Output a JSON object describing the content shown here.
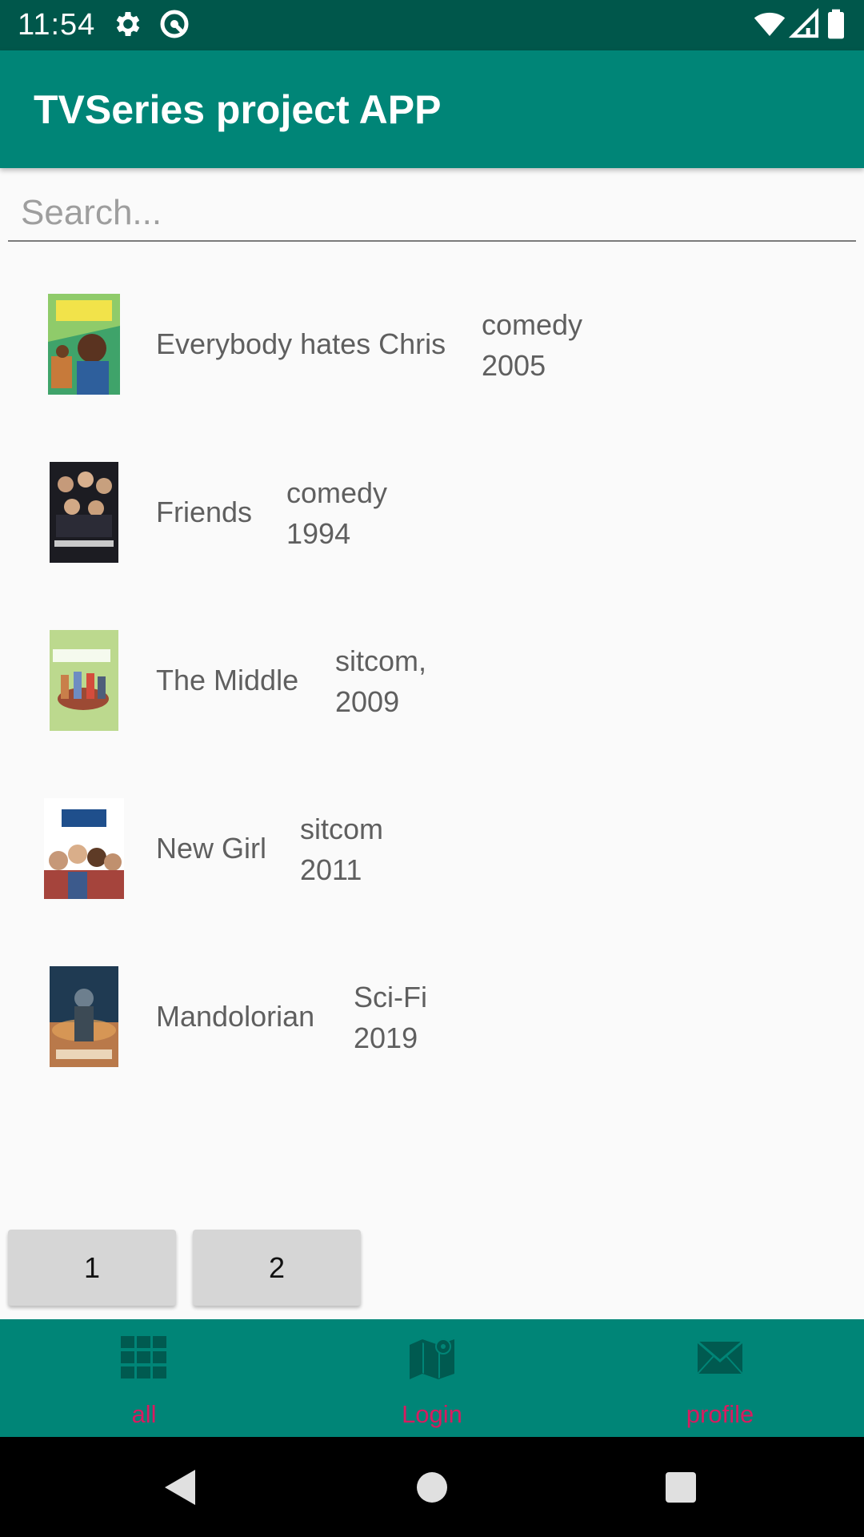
{
  "status_bar": {
    "time": "11:54",
    "icons": [
      "gear-icon",
      "no-sync-icon",
      "wifi-icon",
      "signal-icon",
      "battery-icon"
    ]
  },
  "app_bar": {
    "title": "TVSeries project APP",
    "color": "#008577"
  },
  "search": {
    "placeholder": "Search..."
  },
  "series": [
    {
      "name": "Everybody hates Chris",
      "genre": "comedy",
      "year": "2005",
      "poster": "poster-everybody-hates-chris"
    },
    {
      "name": "Friends",
      "genre": "comedy",
      "year": "1994",
      "poster": "poster-friends"
    },
    {
      "name": "The Middle",
      "genre": "sitcom,",
      "year": "2009",
      "poster": "poster-the-middle"
    },
    {
      "name": "New Girl",
      "genre": "sitcom",
      "year": "2011",
      "poster": "poster-new-girl"
    },
    {
      "name": "Mandolorian",
      "genre": "Sci-Fi",
      "year": "2019",
      "poster": "poster-mandolorian"
    }
  ],
  "pagination": {
    "pages": [
      "1",
      "2"
    ]
  },
  "bottom_nav": {
    "items": [
      {
        "label": "all",
        "icon": "grid-icon"
      },
      {
        "label": "Login",
        "icon": "map-icon"
      },
      {
        "label": "profile",
        "icon": "mail-icon"
      }
    ],
    "label_color": "#d81b60"
  },
  "system_nav": {
    "buttons": [
      "back-icon",
      "home-icon",
      "recents-icon"
    ]
  }
}
